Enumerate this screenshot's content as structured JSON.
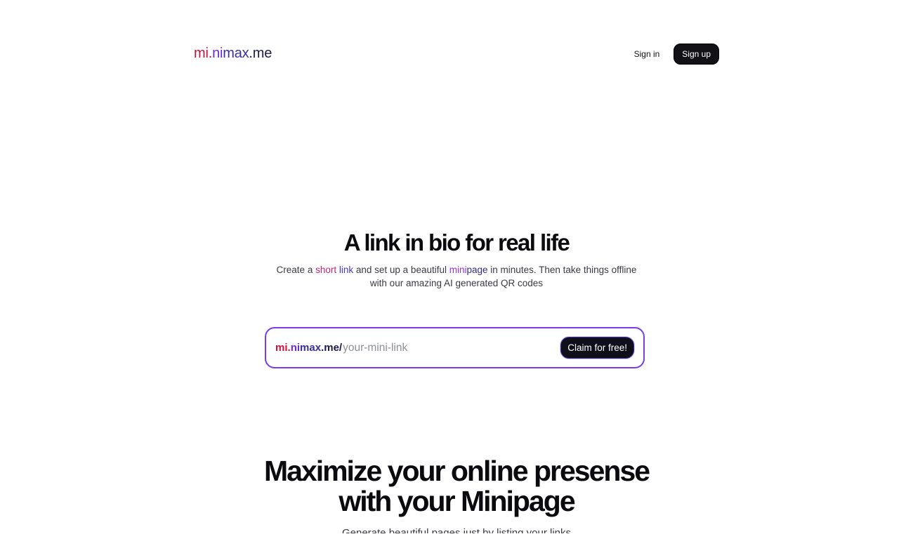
{
  "header": {
    "logo": {
      "part1": "mi.",
      "part2": "ni",
      "part3": "max",
      "part4": ".me"
    },
    "signin_label": "Sign in",
    "signup_label": "Sign up"
  },
  "hero": {
    "title": "A link in bio for real life",
    "subtitle": {
      "t1": "Create a ",
      "short": "short",
      "t2": " ",
      "link": "link",
      "t3": " and set up a beautiful ",
      "mini": "mini",
      "page": "page",
      "t4": " in minutes. Then take things offline with our amazing AI generated QR codes"
    }
  },
  "claim": {
    "prefix": {
      "p1": "mi.",
      "p2": "ni",
      "p3": "max",
      "p4": ".me/"
    },
    "placeholder": "your-mini-link",
    "button_label": "Claim for free!"
  },
  "section": {
    "title_line1": "Maximize your online presense",
    "title_line2": "with your Minipage",
    "subtitle": "Generate beautiful pages just by listing your links"
  },
  "colors": {
    "brand_red": "#d0103a",
    "brand_purple": "#6d28d9",
    "brand_indigo": "#3730a3",
    "brand_dark": "#1e1b4b",
    "claim_border": "#7c3aed"
  }
}
